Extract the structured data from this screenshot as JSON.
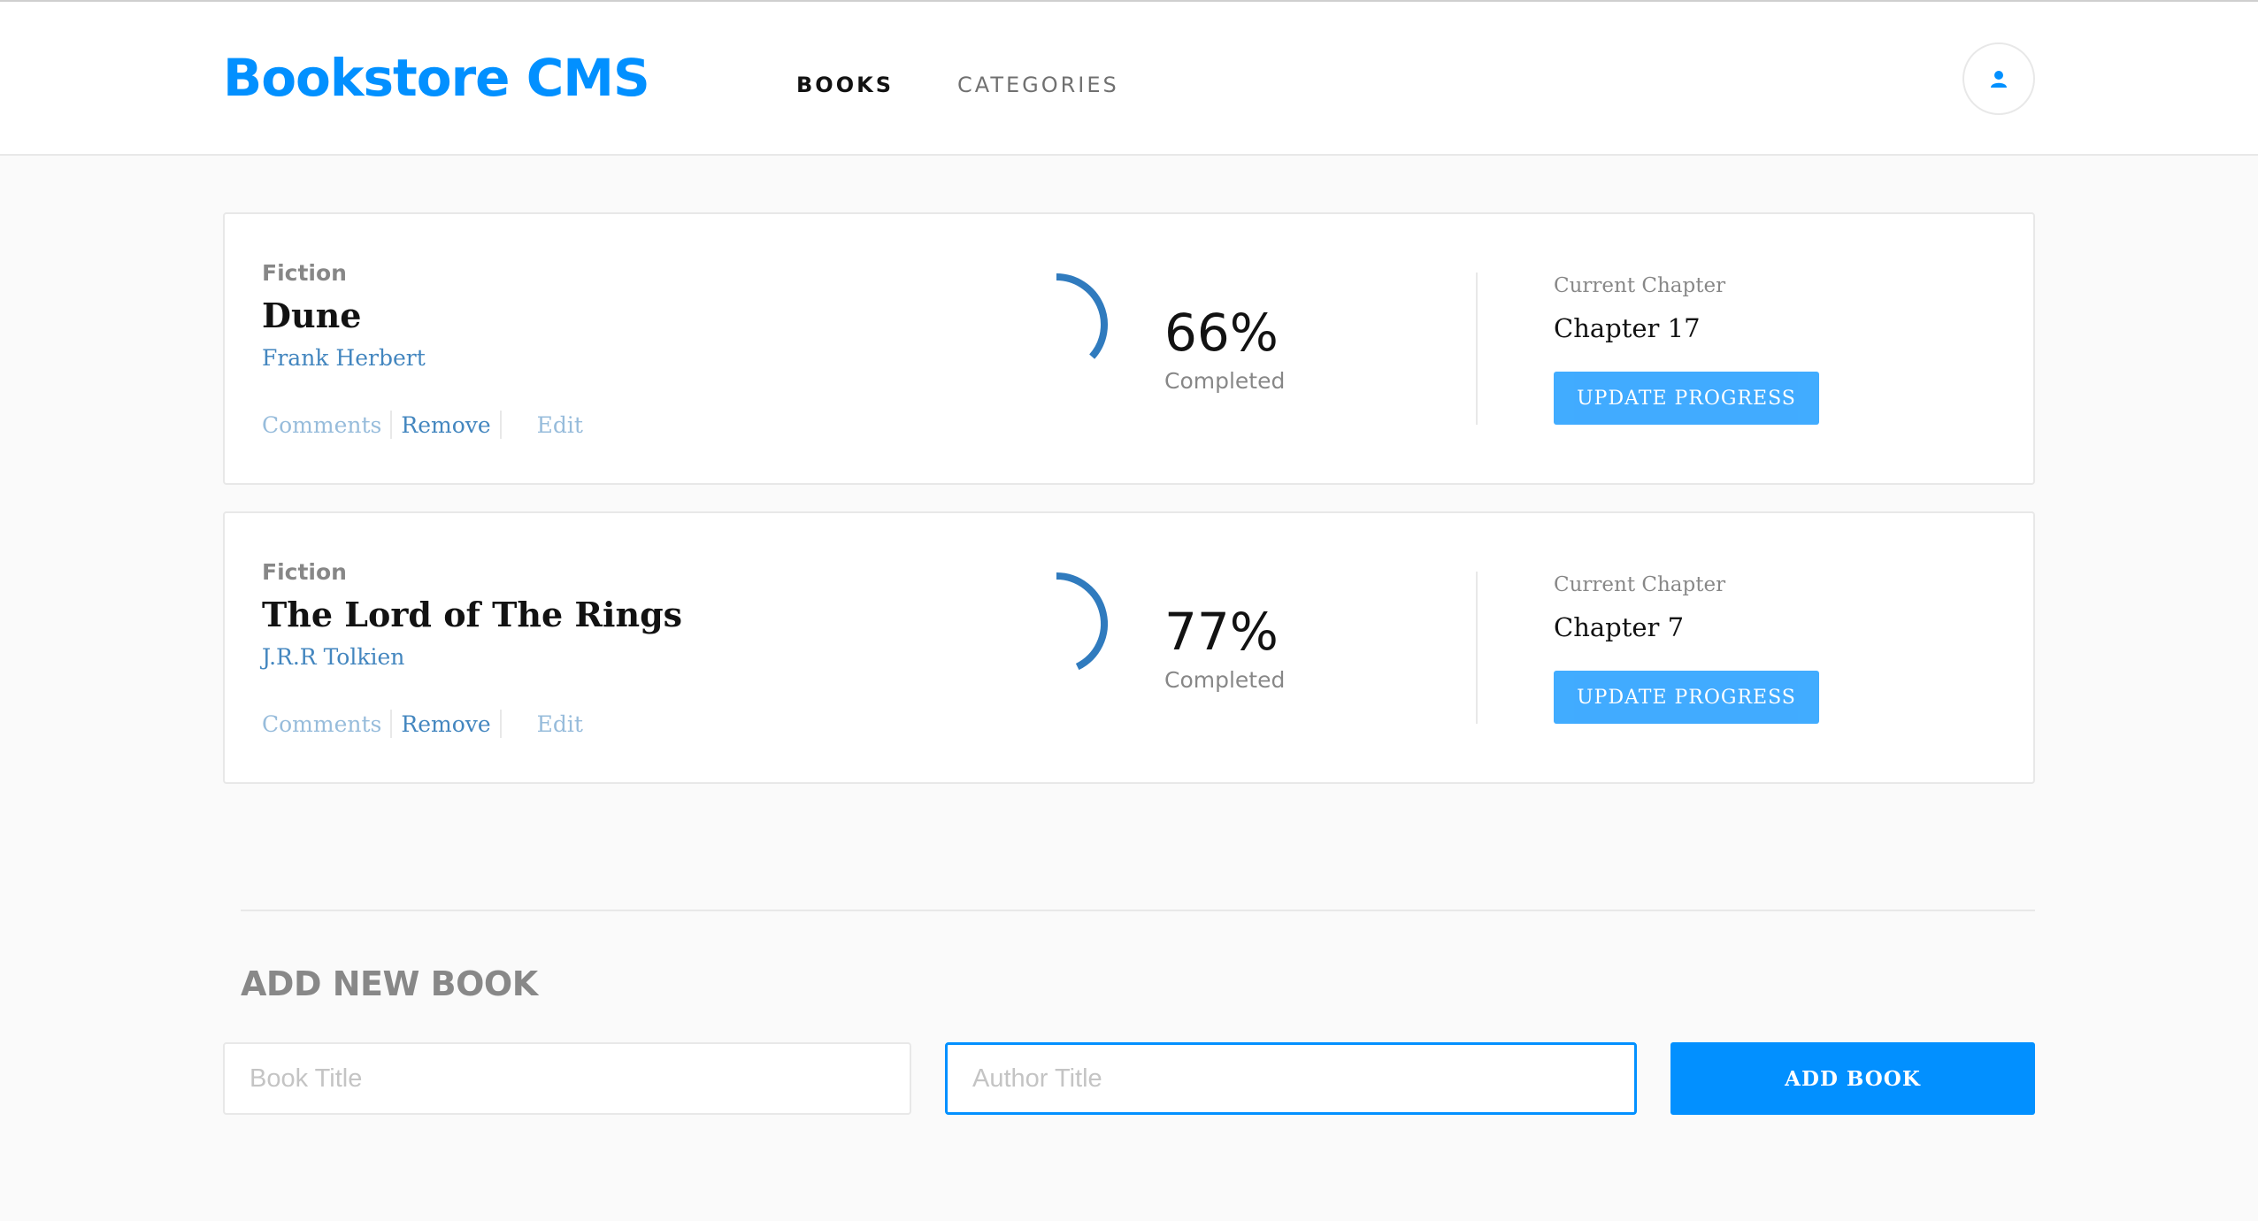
{
  "header": {
    "brand": "Bookstore CMS",
    "nav": {
      "books": "BOOKS",
      "categories": "CATEGORIES"
    },
    "avatar_icon": "user-icon"
  },
  "books": [
    {
      "category": "Fiction",
      "title": "Dune",
      "author": "Frank Herbert",
      "actions": {
        "comments": "Comments",
        "remove": "Remove",
        "edit": "Edit"
      },
      "progress": 66,
      "percent_text": "66%",
      "completed_label": "Completed",
      "chapter_label": "Current Chapter",
      "chapter": "Chapter 17",
      "update_label": "UPDATE PROGRESS"
    },
    {
      "category": "Fiction",
      "title": "The Lord of The Rings",
      "author": "J.R.R Tolkien",
      "actions": {
        "comments": "Comments",
        "remove": "Remove",
        "edit": "Edit"
      },
      "progress": 77,
      "percent_text": "77%",
      "completed_label": "Completed",
      "chapter_label": "Current Chapter",
      "chapter": "Chapter 7",
      "update_label": "UPDATE PROGRESS"
    }
  ],
  "form": {
    "title": "ADD NEW BOOK",
    "title_placeholder": "Book Title",
    "author_placeholder": "Author Title",
    "submit_label": "ADD BOOK"
  },
  "colors": {
    "accent": "#0290ff",
    "link": "#4386bf",
    "progress_arc": "#307bbe"
  }
}
